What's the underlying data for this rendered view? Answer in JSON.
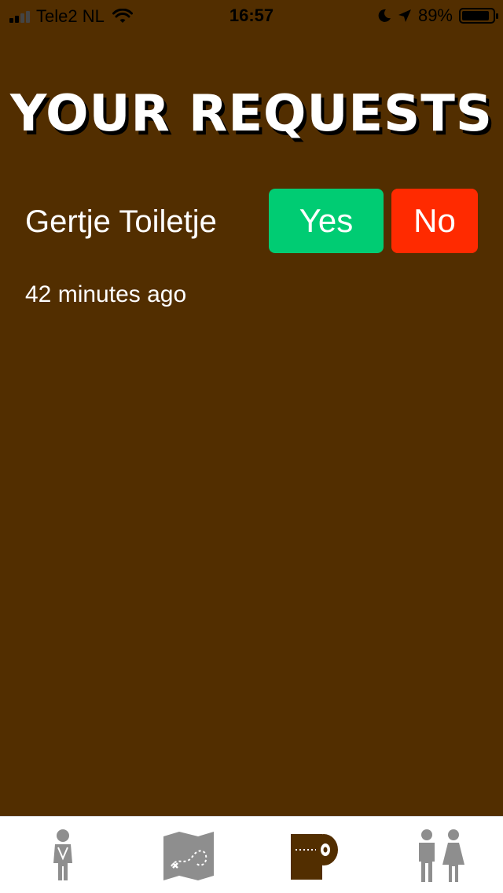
{
  "status_bar": {
    "carrier": "Tele2 NL",
    "time": "16:57",
    "battery": "89%",
    "battery_level": 0.89
  },
  "header": {
    "title": "YOUR REQUESTS"
  },
  "requests": [
    {
      "name": "Gertje Toiletje",
      "yes_label": "Yes",
      "no_label": "No",
      "time_ago": "42 minutes ago"
    }
  ],
  "colors": {
    "background": "#522e00",
    "yes": "#00cc73",
    "no": "#ff2a00",
    "tab_inactive": "#8e8e8e",
    "tab_active": "#522e00"
  },
  "tab_bar": {
    "tabs": [
      {
        "icon": "person-waiting-icon",
        "active": false
      },
      {
        "icon": "treasure-map-icon",
        "active": false
      },
      {
        "icon": "toilet-paper-icon",
        "active": true
      },
      {
        "icon": "man-woman-icon",
        "active": false
      }
    ]
  }
}
